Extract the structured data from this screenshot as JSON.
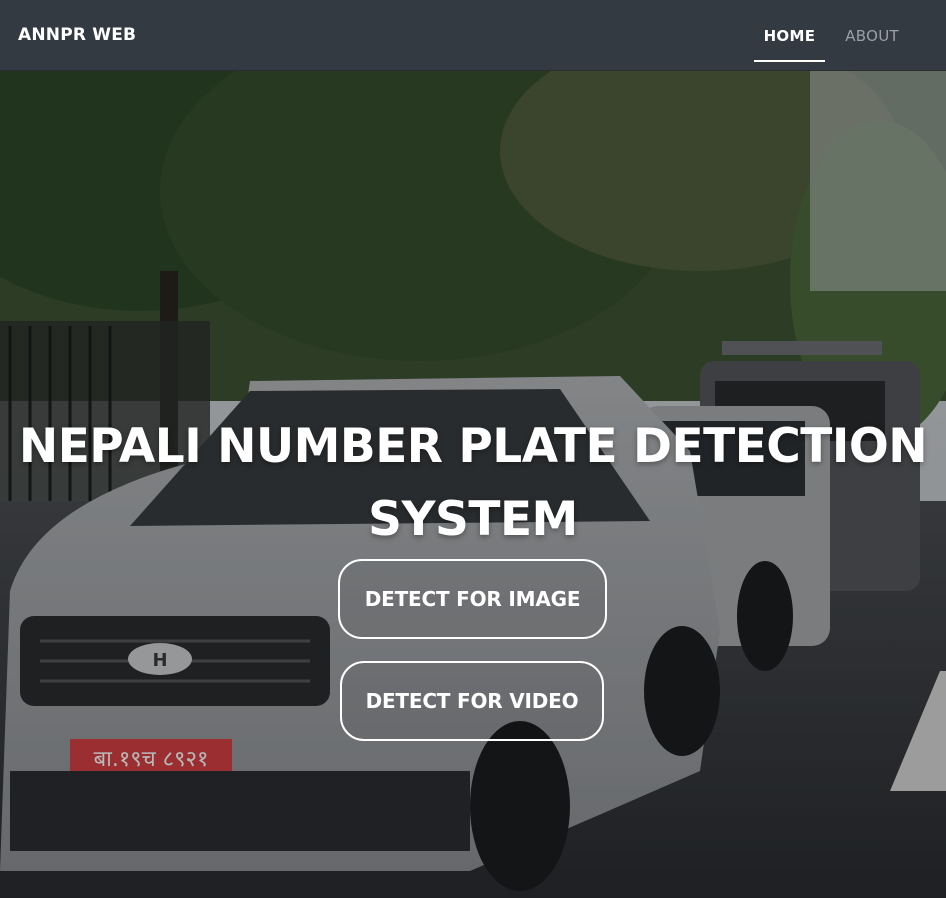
{
  "navbar": {
    "brand": "ANNPR WEB",
    "links": [
      {
        "label": "HOME",
        "active": true
      },
      {
        "label": "ABOUT",
        "active": false
      }
    ]
  },
  "hero": {
    "title": "NEPALI NUMBER PLATE DETECTION SYSTEM",
    "buttons": {
      "image": "DETECT FOR IMAGE",
      "video": "DETECT FOR VIDEO"
    },
    "background": {
      "plate_text": "बा.१९च ८९२१",
      "car_badge": "H"
    }
  },
  "colors": {
    "navbar_bg": "#343a42",
    "text": "#ffffff",
    "inactive_link": "#9aa0a7",
    "plate_red": "#d64045"
  }
}
